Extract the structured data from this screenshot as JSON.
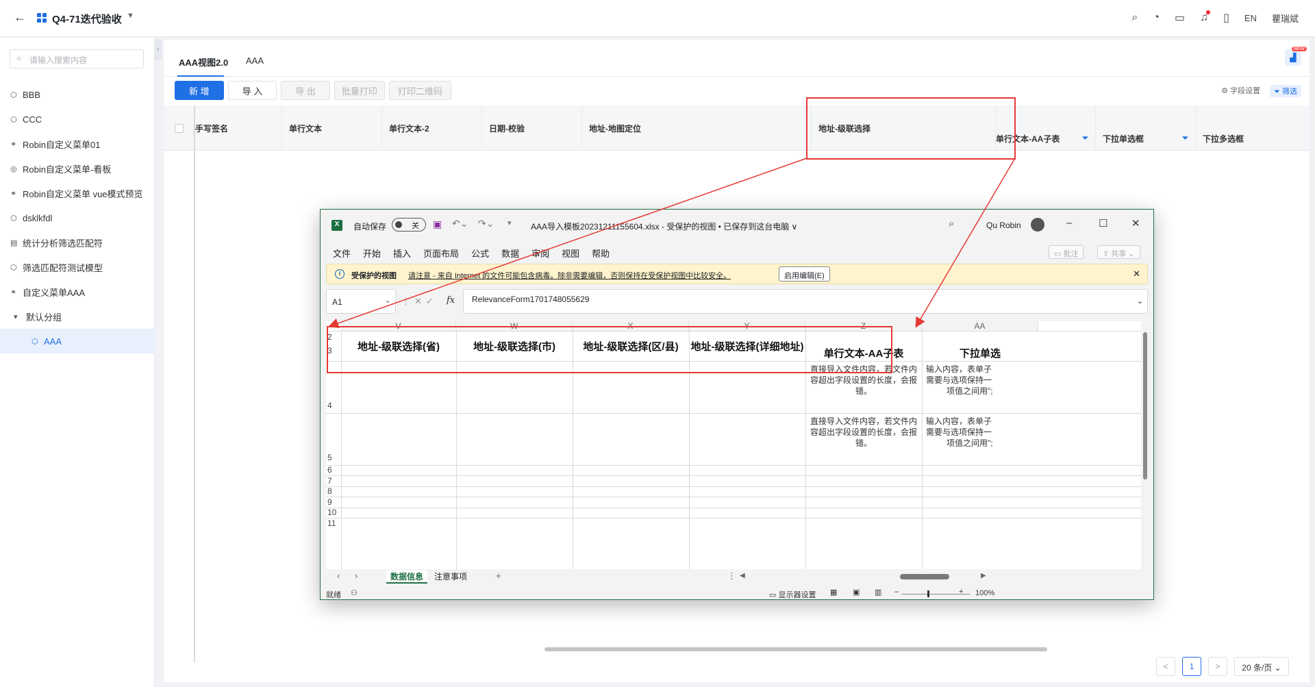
{
  "topbar": {
    "title": "Q4-71迭代验收",
    "lang": "EN",
    "user": "瞿瑞斌"
  },
  "sidebar": {
    "search_placeholder": "请输入搜索内容",
    "items": [
      {
        "label": "BBB",
        "icon": "cube-icon"
      },
      {
        "label": "CCC",
        "icon": "cube-icon"
      },
      {
        "label": "Robin自定义菜单01",
        "icon": "link-icon"
      },
      {
        "label": "Robin自定义菜单-看板",
        "icon": "board-icon"
      },
      {
        "label": "Robin自定义菜单 vue模式预览",
        "icon": "link-icon"
      },
      {
        "label": "dsklkfdl",
        "icon": "cube-icon"
      },
      {
        "label": "统计分析筛选匹配符",
        "icon": "chart-icon"
      },
      {
        "label": "筛选匹配符测试模型",
        "icon": "cube-icon"
      },
      {
        "label": "自定义菜单AAA",
        "icon": "link-icon"
      },
      {
        "label": "默认分组",
        "icon": "caret-icon"
      },
      {
        "label": "AAA",
        "icon": "cube-icon"
      }
    ]
  },
  "tabs": [
    "AAA视图2.0",
    "AAA"
  ],
  "new_badge": "NEW",
  "toolbar": {
    "add": "新 增",
    "import": "导 入",
    "export": "导 出",
    "batch_print": "批量打印",
    "print_qr": "打印二维码",
    "field_settings": "字段设置",
    "filter": "筛选"
  },
  "grid_columns": [
    "手写签名",
    "单行文本",
    "单行文本-2",
    "日期-校验",
    "地址-地图定位",
    "地址-级联选择",
    "单行文本-AA子表",
    "下拉单选框",
    "下拉多选框"
  ],
  "pager": {
    "prev": "<",
    "page": "1",
    "next": ">",
    "size": "20 条/页"
  },
  "excel": {
    "autosave": "自动保存",
    "toggle": "关",
    "filename": "AAA导入模板20231211155604.xlsx  -  受保护的视图 • 已保存到这台电脑 ∨",
    "user": "Qu Robin",
    "menu": [
      "文件",
      "开始",
      "插入",
      "页面布局",
      "公式",
      "数据",
      "审阅",
      "视图",
      "帮助"
    ],
    "comment": "批注",
    "share": "共享",
    "msg_label": "受保护的视图",
    "msg_text": "请注意 - 来自 Internet 的文件可能包含病毒。除非需要编辑，否则保持在受保护视图中比较安全。",
    "enable_edit": "启用编辑(E)",
    "namebox": "A1",
    "formula": "RelevanceForm1701748055629",
    "columns": [
      "V",
      "W",
      "X",
      "Y",
      "Z",
      "AA"
    ],
    "rows": [
      "2",
      "3",
      "4",
      "5",
      "6",
      "7",
      "8",
      "9",
      "10",
      "11"
    ],
    "headers": [
      "地址-级联选择(省)",
      "地址-级联选择(市)",
      "地址-级联选择(区/县)",
      "地址-级联选择(详细地址)",
      "单行文本-AA子表",
      "下拉单选"
    ],
    "z_note_1": "直接导入文件内容，若文件内",
    "z_note_2": "容超出字段设置的长度，会报",
    "z_note_3": "错。",
    "aa_note_1": "输入内容，表单子",
    "aa_note_2": "需要与选项保持一",
    "aa_note_3": "项值之间用\";",
    "sheet_tabs": [
      "数据信息",
      "注意事项"
    ],
    "status": "就绪",
    "display_settings": "显示器设置",
    "zoom": "100%"
  }
}
